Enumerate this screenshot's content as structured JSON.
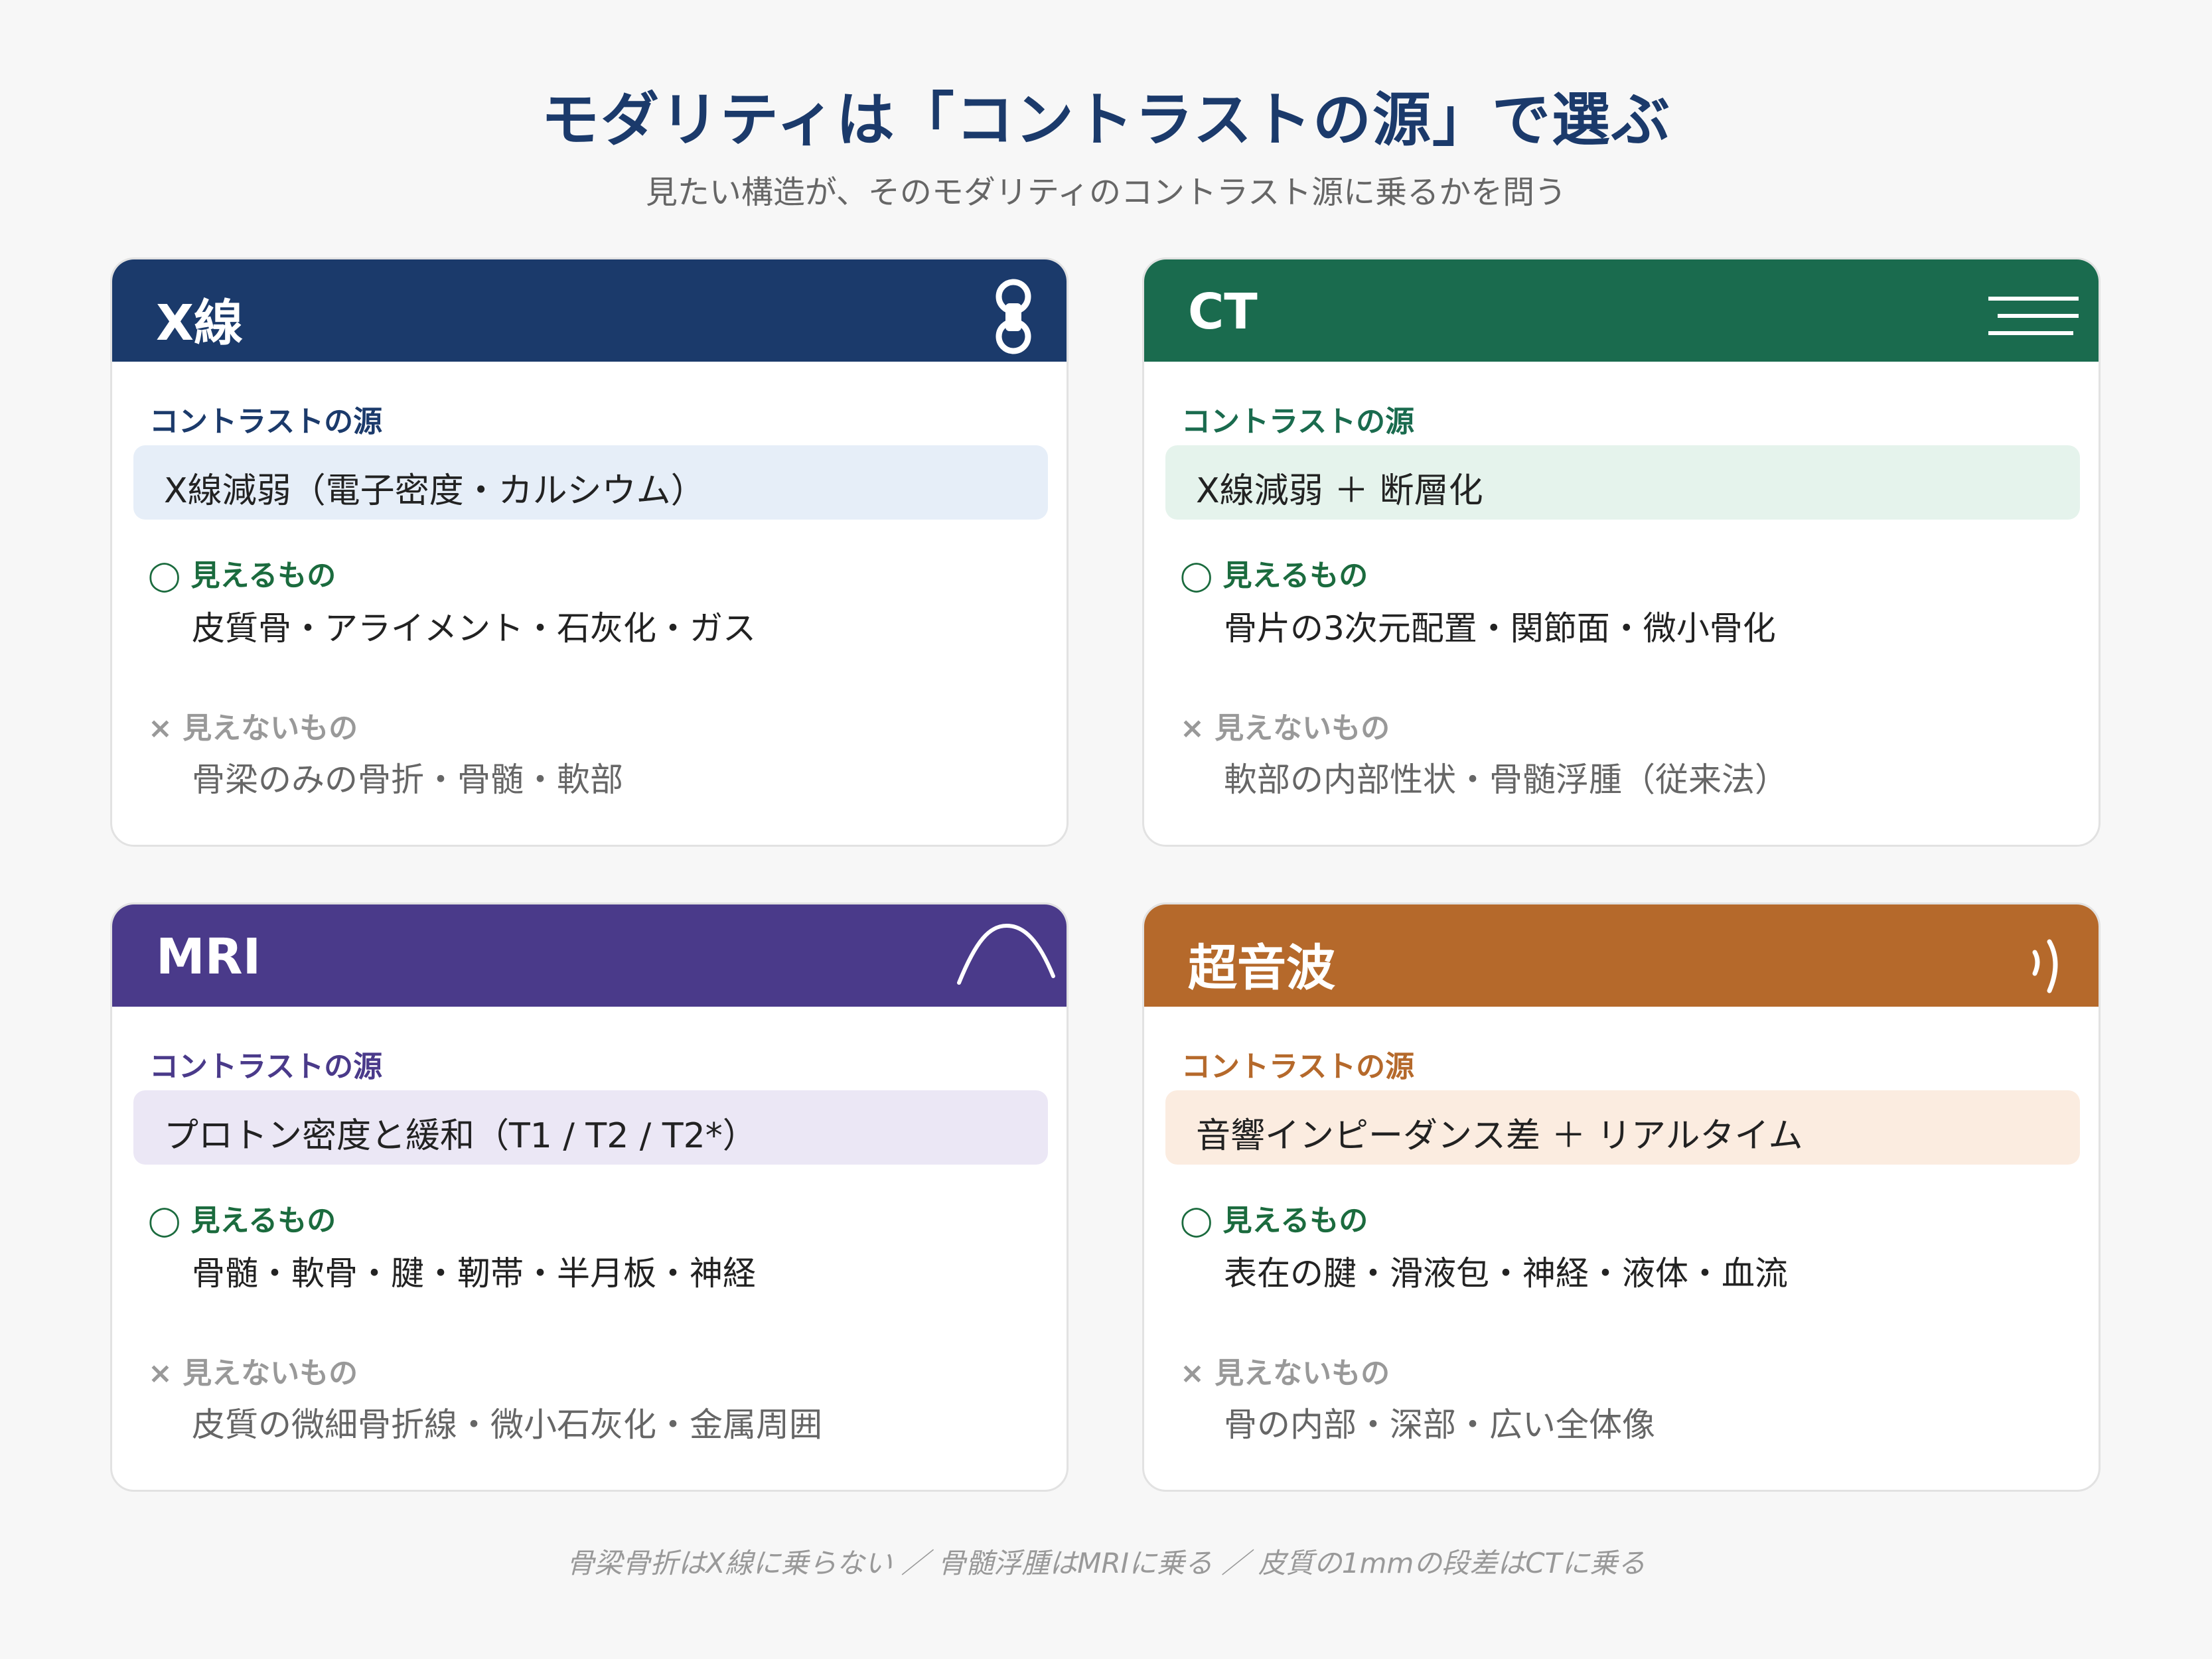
{
  "title": "モダリティは「コントラストの源」で選ぶ",
  "subtitle": "見たい構造が、そのモダリティのコントラスト源に乗るかを問う",
  "colors": {
    "xray": "#1b3a6b",
    "ct": "#1a6b4e",
    "mri": "#4a3a8a",
    "us": "#b5692b",
    "xray_bg": "#e6eef8",
    "ct_bg": "#e5f3ec",
    "mri_bg": "#ebe7f5",
    "us_bg": "#fbece0"
  },
  "cards": [
    {
      "title": "X線",
      "icon": "bone-icon",
      "source_label": "コントラストの源",
      "source": "X線減弱（電子密度・カルシウム）",
      "visible_label": "◯ 見えるもの",
      "visible": "皮質骨・アライメント・石灰化・ガス",
      "invisible_label": "× 見えないもの",
      "invisible": "骨梁のみの骨折・骨髄・軟部"
    },
    {
      "title": "CT",
      "icon": "slices-icon",
      "source_label": "コントラストの源",
      "source": "X線減弱 ＋ 断層化",
      "visible_label": "◯ 見えるもの",
      "visible": "骨片の3次元配置・関節面・微小骨化",
      "invisible_label": "× 見えないもの",
      "invisible": "軟部の内部性状・骨髄浮腫（従来法）"
    },
    {
      "title": "MRI",
      "icon": "signal-curve-icon",
      "source_label": "コントラストの源",
      "source": "プロトン密度と緩和（T1 / T2 / T2*）",
      "visible_label": "◯ 見えるもの",
      "visible": "骨髄・軟骨・腱・靭帯・半月板・神経",
      "invisible_label": "× 見えないもの",
      "invisible": "皮質の微細骨折線・微小石灰化・金属周囲"
    },
    {
      "title": "超音波",
      "icon": "sound-wave-icon",
      "source_label": "コントラストの源",
      "source": "音響インピーダンス差 ＋ リアルタイム",
      "visible_label": "◯ 見えるもの",
      "visible": "表在の腱・滑液包・神経・液体・血流",
      "invisible_label": "× 見えないもの",
      "invisible": "骨の内部・深部・広い全体像"
    }
  ],
  "footnote": "骨梁骨折はX線に乗らない ／ 骨髄浮腫はMRIに乗る ／ 皮質の1mmの段差はCTに乗る"
}
